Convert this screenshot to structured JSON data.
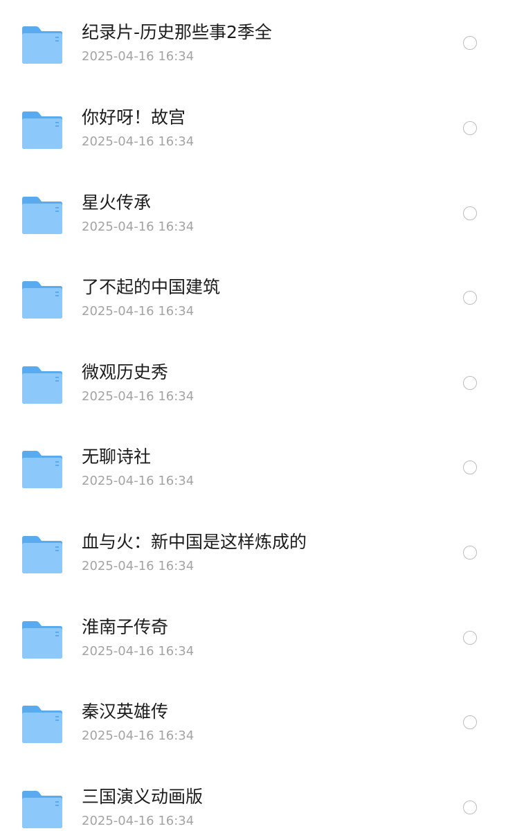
{
  "files": [
    {
      "name": "纪录片-历史那些事2季全",
      "date": "2025-04-16 16:34",
      "icon": "folder-icon"
    },
    {
      "name": "你好呀！故宫",
      "date": "2025-04-16 16:34",
      "icon": "folder-icon"
    },
    {
      "name": "星火传承",
      "date": "2025-04-16 16:34",
      "icon": "folder-icon"
    },
    {
      "name": "了不起的中国建筑",
      "date": "2025-04-16 16:34",
      "icon": "folder-icon"
    },
    {
      "name": "微观历史秀",
      "date": "2025-04-16 16:34",
      "icon": "folder-icon"
    },
    {
      "name": "无聊诗社",
      "date": "2025-04-16 16:34",
      "icon": "folder-icon"
    },
    {
      "name": "血与火：新中国是这样炼成的",
      "date": "2025-04-16 16:34",
      "icon": "folder-icon"
    },
    {
      "name": "淮南子传奇",
      "date": "2025-04-16 16:34",
      "icon": "folder-icon"
    },
    {
      "name": "秦汉英雄传",
      "date": "2025-04-16 16:34",
      "icon": "folder-icon"
    },
    {
      "name": "三国演义动画版",
      "date": "2025-04-16 16:34",
      "icon": "folder-icon"
    }
  ],
  "colors": {
    "folder_back": "#5aaaf0",
    "folder_front": "#8cc8fa",
    "title_text": "#1c1c1c",
    "date_text": "#a3a3a3",
    "radio_border": "#bdbdbd"
  }
}
